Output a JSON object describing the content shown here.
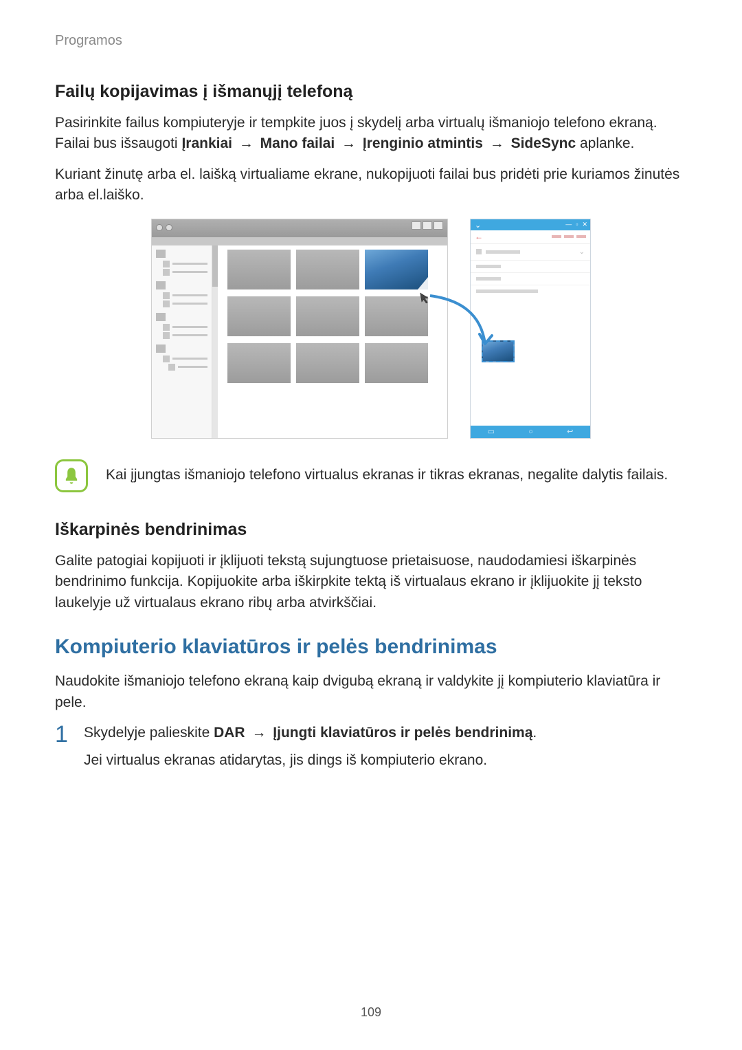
{
  "header": "Programos",
  "section1": {
    "heading": "Failų kopijavimas į išmanųjį telefoną",
    "p1a": "Pasirinkite failus kompiuteryje ir tempkite juos į skydelį arba virtualų išmaniojo telefono ekraną. Failai bus išsaugoti ",
    "b1": "Įrankiai",
    "b2": "Mano failai",
    "b3": "Įrenginio atmintis",
    "b4": "SideSync",
    "p1b": " aplanke.",
    "p2": "Kuriant žinutę arba el. laišką virtualiame ekrane, nukopijuoti failai bus pridėti prie kuriamos žinutės arba el.laiško."
  },
  "note": {
    "text": "Kai įjungtas išmaniojo telefono virtualus ekranas ir tikras ekranas, negalite dalytis failais."
  },
  "section2": {
    "heading": "Iškarpinės bendrinimas",
    "p1": "Galite patogiai kopijuoti ir įklijuoti tekstą sujungtuose prietaisuose, naudodamiesi iškarpinės bendrinimo funkcija. Kopijuokite arba iškirpkite tektą iš virtualaus ekrano ir įklijuokite jį teksto laukelyje už virtualaus ekrano ribų arba atvirkščiai."
  },
  "section3": {
    "heading": "Kompiuterio klaviatūros ir pelės bendrinimas",
    "p1": "Naudokite išmaniojo telefono ekraną kaip dvigubą ekraną ir valdykite jį kompiuterio klaviatūra ir pele."
  },
  "step1": {
    "num": "1",
    "a": "Skydelyje palieskite ",
    "b1": "DAR",
    "b2": "Įjungti klaviatūros ir pelės bendrinimą",
    "p2": "Jei virtualus ekranas atidarytas, jis dings iš kompiuterio ekrano."
  },
  "pagenum": "109",
  "arrow": "→"
}
